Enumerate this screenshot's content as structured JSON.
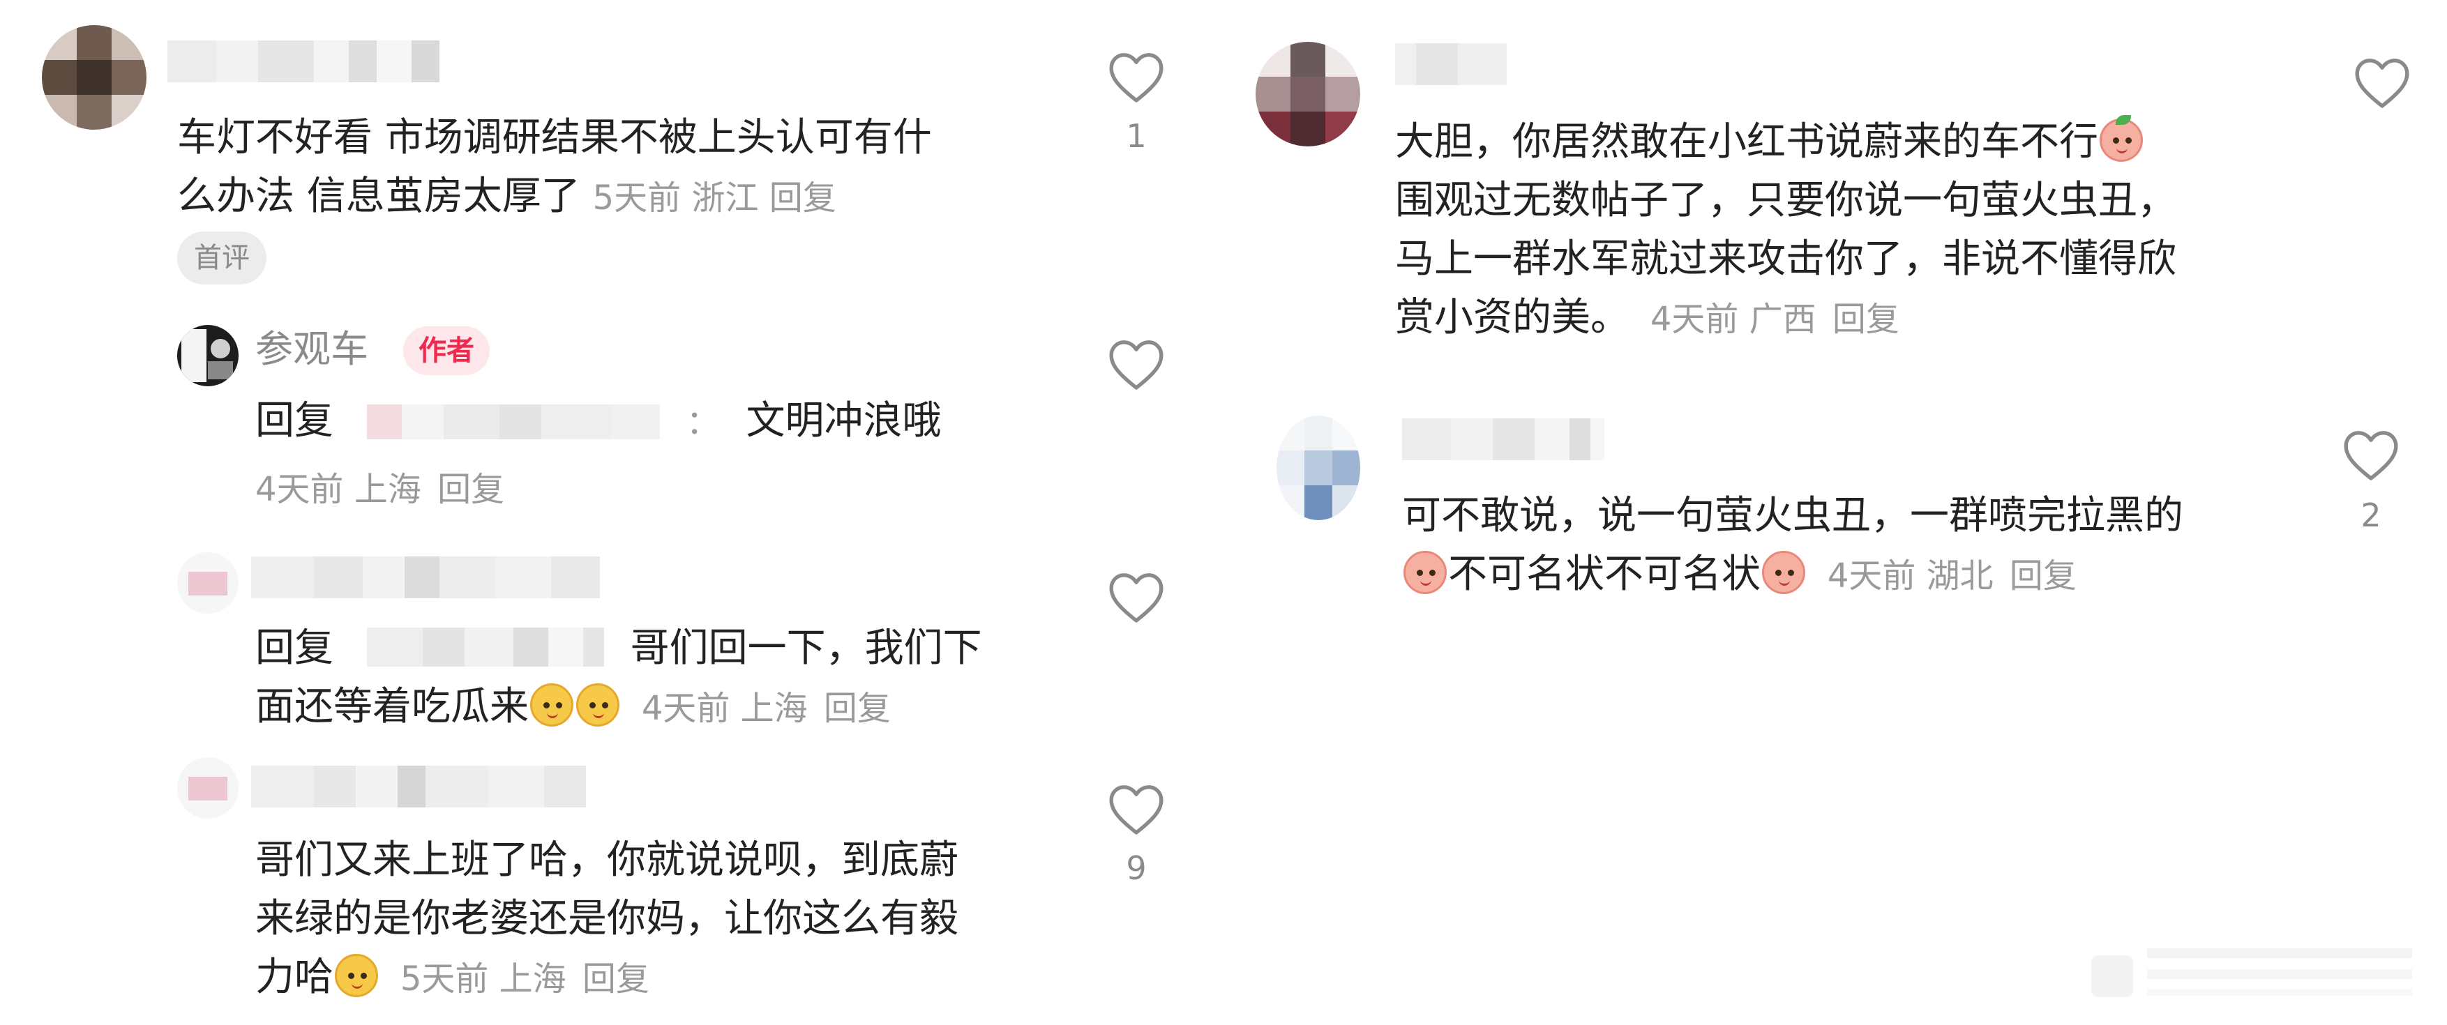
{
  "left_column": {
    "comment1": {
      "text_line1": "车灯不好看 市场调研结果不被上头认可有什",
      "text_line2": "么办法 信息茧房太厚了",
      "time": "5天前",
      "location": "浙江",
      "reply_label": "回复",
      "tag": "首评",
      "likes": "1"
    },
    "reply1": {
      "author_name": "参观车",
      "author_badge": "作者",
      "reply_prefix": "回复",
      "reply_separator": "：",
      "text": "文明冲浪哦",
      "time": "4天前",
      "location": "上海",
      "reply_label": "回复"
    },
    "reply2": {
      "reply_prefix": "回复",
      "text_line1": "哥们回一下，我们下",
      "text_line2": "面还等着吃瓜来",
      "time": "4天前",
      "location": "上海",
      "reply_label": "回复"
    },
    "reply3": {
      "text_line1": "哥们又来上班了哈，你就说说呗，到底蔚",
      "text_line2": "来绿的是你老婆还是你妈，让你这么有毅",
      "text_line3": "力哈",
      "time": "5天前",
      "location": "上海",
      "reply_label": "回复",
      "likes": "9"
    }
  },
  "right_column": {
    "comment1": {
      "text_line1": "大胆，你居然敢在小红书说蔚来的车不行",
      "text_line2": "围观过无数帖子了，只要你说一句萤火虫丑，",
      "text_line3": "马上一群水军就过来攻击你了，非说不懂得欣",
      "text_line4": "赏小资的美。",
      "time": "4天前",
      "location": "广西",
      "reply_label": "回复"
    },
    "comment2": {
      "text_line1": "可不敢说，说一句萤火虫丑，一群喷完拉黑的",
      "text_line2": "不可名状不可名状",
      "time": "4天前",
      "location": "湖北",
      "reply_label": "回复",
      "likes": "2"
    }
  },
  "icons": {
    "like": "heart-outline-icon",
    "emoji_melon": "melon-face-emoji",
    "emoji_peach": "peach-face-emoji"
  },
  "colors": {
    "author_badge_bg": "#fde7ea",
    "author_badge_text": "#f0294f",
    "meta_text": "#9a9a9a",
    "body_text": "#222222"
  }
}
